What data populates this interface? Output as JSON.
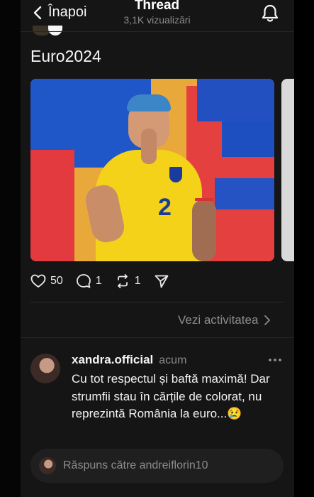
{
  "header": {
    "back_label": "Înapoi",
    "title": "Thread",
    "subtitle": "3,1K vizualizări"
  },
  "post": {
    "text": "Euro2024",
    "image_alt": "Jucător cu tricou galben nr. 2, gest de liniște, fundal albastru-galben-roșu",
    "jersey_number": "2",
    "actions": {
      "likes": "50",
      "comments": "1",
      "reposts": "1"
    },
    "activity_label": "Vezi activitatea"
  },
  "reply": {
    "username": "xandra.official",
    "time": "acum",
    "text": "Cu tot respectul și baftă maximă! Dar strumfii stau în cărțile de colorat, nu reprezintă România la euro...😢"
  },
  "composer": {
    "placeholder": "Răspuns către andreiflorin10"
  },
  "icons": {
    "back": "chevron-left-icon",
    "bell": "bell-icon",
    "like": "heart-icon",
    "comment": "comment-icon",
    "repost": "repost-icon",
    "share": "send-icon",
    "activity": "chevron-right-icon",
    "more": "more-icon"
  },
  "colors": {
    "background": "#050505",
    "panel": "#151515",
    "text": "#f2f2f2",
    "muted": "#8a8a8a"
  }
}
